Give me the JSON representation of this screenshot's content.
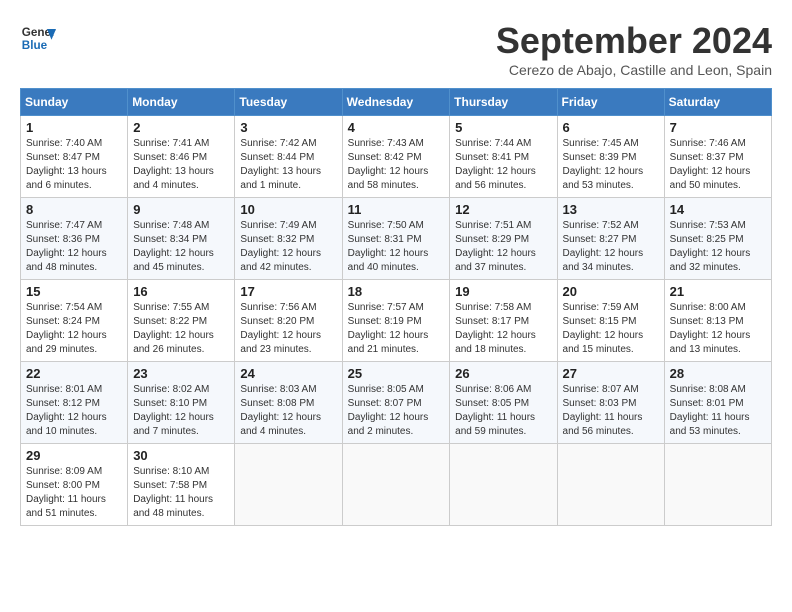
{
  "header": {
    "logo_general": "General",
    "logo_blue": "Blue",
    "month": "September 2024",
    "location": "Cerezo de Abajo, Castille and Leon, Spain"
  },
  "weekdays": [
    "Sunday",
    "Monday",
    "Tuesday",
    "Wednesday",
    "Thursday",
    "Friday",
    "Saturday"
  ],
  "weeks": [
    [
      {
        "day": "1",
        "info": "Sunrise: 7:40 AM\nSunset: 8:47 PM\nDaylight: 13 hours and 6 minutes."
      },
      {
        "day": "2",
        "info": "Sunrise: 7:41 AM\nSunset: 8:46 PM\nDaylight: 13 hours and 4 minutes."
      },
      {
        "day": "3",
        "info": "Sunrise: 7:42 AM\nSunset: 8:44 PM\nDaylight: 13 hours and 1 minute."
      },
      {
        "day": "4",
        "info": "Sunrise: 7:43 AM\nSunset: 8:42 PM\nDaylight: 12 hours and 58 minutes."
      },
      {
        "day": "5",
        "info": "Sunrise: 7:44 AM\nSunset: 8:41 PM\nDaylight: 12 hours and 56 minutes."
      },
      {
        "day": "6",
        "info": "Sunrise: 7:45 AM\nSunset: 8:39 PM\nDaylight: 12 hours and 53 minutes."
      },
      {
        "day": "7",
        "info": "Sunrise: 7:46 AM\nSunset: 8:37 PM\nDaylight: 12 hours and 50 minutes."
      }
    ],
    [
      {
        "day": "8",
        "info": "Sunrise: 7:47 AM\nSunset: 8:36 PM\nDaylight: 12 hours and 48 minutes."
      },
      {
        "day": "9",
        "info": "Sunrise: 7:48 AM\nSunset: 8:34 PM\nDaylight: 12 hours and 45 minutes."
      },
      {
        "day": "10",
        "info": "Sunrise: 7:49 AM\nSunset: 8:32 PM\nDaylight: 12 hours and 42 minutes."
      },
      {
        "day": "11",
        "info": "Sunrise: 7:50 AM\nSunset: 8:31 PM\nDaylight: 12 hours and 40 minutes."
      },
      {
        "day": "12",
        "info": "Sunrise: 7:51 AM\nSunset: 8:29 PM\nDaylight: 12 hours and 37 minutes."
      },
      {
        "day": "13",
        "info": "Sunrise: 7:52 AM\nSunset: 8:27 PM\nDaylight: 12 hours and 34 minutes."
      },
      {
        "day": "14",
        "info": "Sunrise: 7:53 AM\nSunset: 8:25 PM\nDaylight: 12 hours and 32 minutes."
      }
    ],
    [
      {
        "day": "15",
        "info": "Sunrise: 7:54 AM\nSunset: 8:24 PM\nDaylight: 12 hours and 29 minutes."
      },
      {
        "day": "16",
        "info": "Sunrise: 7:55 AM\nSunset: 8:22 PM\nDaylight: 12 hours and 26 minutes."
      },
      {
        "day": "17",
        "info": "Sunrise: 7:56 AM\nSunset: 8:20 PM\nDaylight: 12 hours and 23 minutes."
      },
      {
        "day": "18",
        "info": "Sunrise: 7:57 AM\nSunset: 8:19 PM\nDaylight: 12 hours and 21 minutes."
      },
      {
        "day": "19",
        "info": "Sunrise: 7:58 AM\nSunset: 8:17 PM\nDaylight: 12 hours and 18 minutes."
      },
      {
        "day": "20",
        "info": "Sunrise: 7:59 AM\nSunset: 8:15 PM\nDaylight: 12 hours and 15 minutes."
      },
      {
        "day": "21",
        "info": "Sunrise: 8:00 AM\nSunset: 8:13 PM\nDaylight: 12 hours and 13 minutes."
      }
    ],
    [
      {
        "day": "22",
        "info": "Sunrise: 8:01 AM\nSunset: 8:12 PM\nDaylight: 12 hours and 10 minutes."
      },
      {
        "day": "23",
        "info": "Sunrise: 8:02 AM\nSunset: 8:10 PM\nDaylight: 12 hours and 7 minutes."
      },
      {
        "day": "24",
        "info": "Sunrise: 8:03 AM\nSunset: 8:08 PM\nDaylight: 12 hours and 4 minutes."
      },
      {
        "day": "25",
        "info": "Sunrise: 8:05 AM\nSunset: 8:07 PM\nDaylight: 12 hours and 2 minutes."
      },
      {
        "day": "26",
        "info": "Sunrise: 8:06 AM\nSunset: 8:05 PM\nDaylight: 11 hours and 59 minutes."
      },
      {
        "day": "27",
        "info": "Sunrise: 8:07 AM\nSunset: 8:03 PM\nDaylight: 11 hours and 56 minutes."
      },
      {
        "day": "28",
        "info": "Sunrise: 8:08 AM\nSunset: 8:01 PM\nDaylight: 11 hours and 53 minutes."
      }
    ],
    [
      {
        "day": "29",
        "info": "Sunrise: 8:09 AM\nSunset: 8:00 PM\nDaylight: 11 hours and 51 minutes."
      },
      {
        "day": "30",
        "info": "Sunrise: 8:10 AM\nSunset: 7:58 PM\nDaylight: 11 hours and 48 minutes."
      },
      {
        "day": "",
        "info": ""
      },
      {
        "day": "",
        "info": ""
      },
      {
        "day": "",
        "info": ""
      },
      {
        "day": "",
        "info": ""
      },
      {
        "day": "",
        "info": ""
      }
    ]
  ]
}
